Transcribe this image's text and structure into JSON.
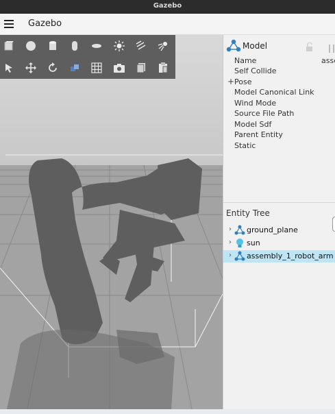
{
  "window": {
    "title": "Gazebo"
  },
  "appbar": {
    "title": "Gazebo",
    "menu_icon": "hamburger-icon"
  },
  "toolbar": {
    "row1": [
      "box-shape-icon",
      "sphere-shape-icon",
      "cylinder-shape-icon",
      "capsule-shape-icon",
      "ellipsoid-shape-icon",
      "sun-light-icon",
      "directional-light-icon",
      "spot-light-icon"
    ],
    "row2": [
      "select-arrow-icon",
      "translate-icon",
      "rotate-icon",
      "snap-icon",
      "grid-icon",
      "screenshot-icon",
      "copy-icon",
      "paste-icon"
    ]
  },
  "component_inspector": {
    "title": "Model",
    "properties": [
      {
        "label": "Name",
        "value": "asse",
        "expandable": false
      },
      {
        "label": "Self Collide",
        "value": "",
        "expandable": false
      },
      {
        "label": "Pose",
        "value": "",
        "expandable": true,
        "prefix": "+"
      },
      {
        "label": "Model Canonical Link",
        "value": "",
        "expandable": false
      },
      {
        "label": "Wind Mode",
        "value": "",
        "expandable": false
      },
      {
        "label": "Source File Path",
        "value": "",
        "expandable": false
      },
      {
        "label": "Model Sdf",
        "value": "",
        "expandable": false
      },
      {
        "label": "Parent Entity",
        "value": "",
        "expandable": false
      },
      {
        "label": "Static",
        "value": "",
        "expandable": false
      }
    ]
  },
  "entity_tree": {
    "title": "Entity Tree",
    "items": [
      {
        "label": "ground_plane",
        "icon": "model-icon",
        "selected": false
      },
      {
        "label": "sun",
        "icon": "light-bulb-icon",
        "selected": false
      },
      {
        "label": "assembly_1_robot_arm",
        "icon": "model-icon",
        "selected": true
      }
    ]
  },
  "colors": {
    "selected_row": "#bfe4f4",
    "viewport_bg": "#9a9a9a",
    "toolbar_bg": "#5e5e5e",
    "model_icon": "#2f7fc1"
  }
}
